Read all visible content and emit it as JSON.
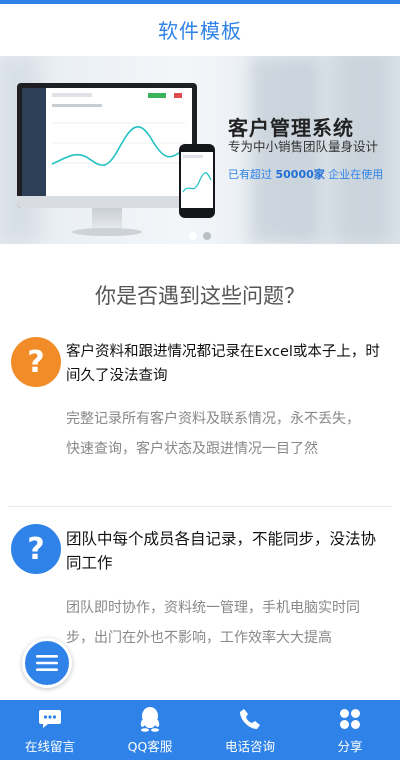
{
  "header": {
    "title": "软件模板"
  },
  "banner": {
    "title": "客户管理系统",
    "subtitle": "专为中小销售团队量身设计",
    "note_prefix": "已有超过 ",
    "note_count": "50000家",
    "note_suffix": " 企业在使用",
    "active_slide": 1,
    "slide_count": 2
  },
  "problems": {
    "title": "你是否遇到这些问题？",
    "items": [
      {
        "icon": "question-icon",
        "icon_color": "#f28c28",
        "heading": "客户资料和跟进情况都记录在Excel或本子上，时间久了没法查询",
        "description": "完整记录所有客户资料及联系情况，永不丢失，快速查询，客户状态及跟进情况一目了然"
      },
      {
        "icon": "question-icon",
        "icon_color": "#2f83e8",
        "heading": "团队中每个成员各自记录，不能同步，没法协同工作",
        "description": "团队即时协作，资料统一管理，手机电脑实时同步，出门在外也不影响，工作效率大大提高"
      }
    ]
  },
  "fab": {
    "icon": "menu-icon"
  },
  "bottom_nav": [
    {
      "label": "在线留言",
      "icon": "chat-icon"
    },
    {
      "label": "QQ客服",
      "icon": "qq-icon"
    },
    {
      "label": "电话咨询",
      "icon": "phone-icon"
    },
    {
      "label": "分享",
      "icon": "share-grid-icon"
    }
  ],
  "colors": {
    "accent": "#2f83e8",
    "warning": "#f28c28"
  }
}
